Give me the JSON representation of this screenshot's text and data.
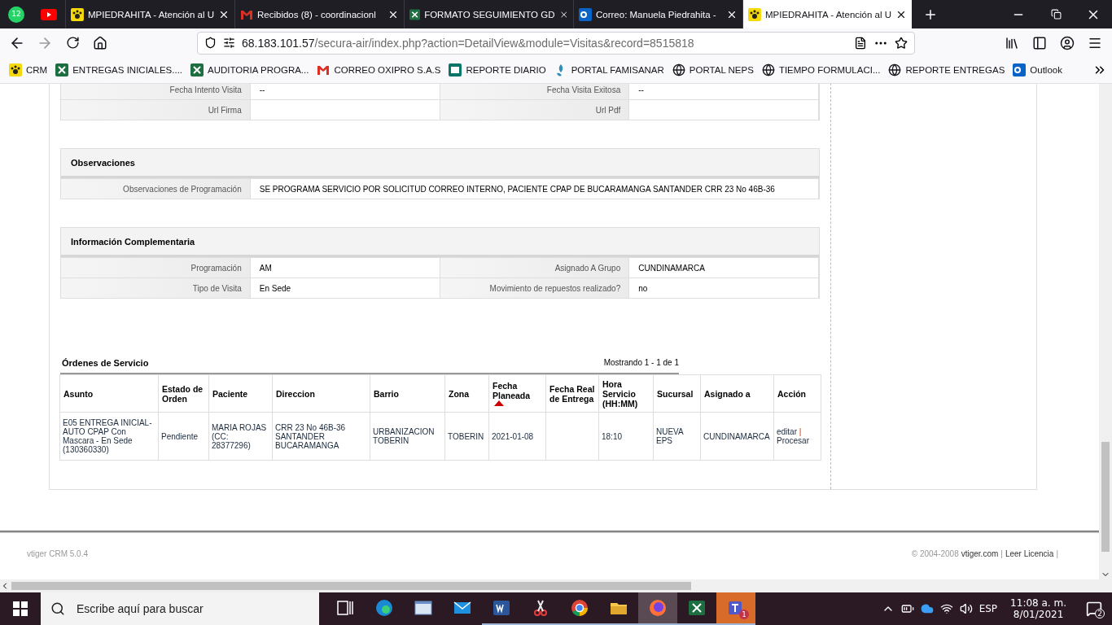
{
  "browser": {
    "tabs": [
      {
        "kind": "whatsapp",
        "badge": "12",
        "selected": false
      },
      {
        "kind": "youtube",
        "selected": false
      },
      {
        "kind": "crm",
        "title": "MPIEDRAHITA - Atención al U",
        "selected": false
      },
      {
        "kind": "gmail",
        "title": "Recibidos (8) - coordinacionl",
        "selected": false
      },
      {
        "kind": "excel",
        "title": "FORMATO SEGUIMIENTO GD",
        "selected": false
      },
      {
        "kind": "outlook",
        "title": "Correo: Manuela Piedrahita -",
        "selected": false
      },
      {
        "kind": "crm",
        "title": "MPIEDRAHITA - Atención al U",
        "selected": true
      }
    ],
    "url": {
      "host": "68.183.101.57",
      "path": "/secura-air/index.php?action=DetailView&module=Visitas&record=8515818"
    },
    "bookmarks": [
      {
        "kind": "crm",
        "label": "CRM"
      },
      {
        "kind": "excel",
        "label": "ENTREGAS INICIALES...."
      },
      {
        "kind": "excel",
        "label": "AUDITORIA PROGRA..."
      },
      {
        "kind": "gmail",
        "label": "CORREO OXIPRO S.A.S"
      },
      {
        "kind": "sheet",
        "label": "REPORTE DIARIO"
      },
      {
        "kind": "famisanar",
        "label": "PORTAL FAMISANAR"
      },
      {
        "kind": "globe",
        "label": "PORTAL NEPS"
      },
      {
        "kind": "globe",
        "label": "TIEMPO FORMULACI..."
      },
      {
        "kind": "globe",
        "label": "REPORTE ENTREGAS"
      },
      {
        "kind": "outlook",
        "label": "Outlook"
      }
    ]
  },
  "fields": [
    [
      {
        "label": "Fecha Intento Visita",
        "value": "--"
      },
      {
        "label": "Fecha Visita Exitosa",
        "value": "--"
      }
    ],
    [
      {
        "label": "Url Firma"
      },
      {
        "label": "Url Pdf"
      }
    ]
  ],
  "sections": [
    {
      "title": "Observaciones",
      "rows": [
        [
          {
            "label": "Observaciones de Programación",
            "value": "SE PROGRAMA SERVICIO POR SOLICITUD CORREO INTERNO, PACIENTE CPAP DE BUCARAMANGA SANTANDER CRR 23 No 46B-36"
          }
        ]
      ]
    },
    {
      "title": "Información Complementaria",
      "rows": [
        [
          {
            "label": "Programación",
            "value": "AM"
          },
          {
            "label": "Asignado A Grupo",
            "value": "CUNDINAMARCA"
          }
        ],
        [
          {
            "label": "Tipo de Visita",
            "value": "En Sede"
          },
          {
            "label": "Movimiento de repuestos realizado?",
            "value": "no"
          }
        ]
      ]
    }
  ],
  "orders": {
    "title": "Órdenes de Servicio",
    "count": "Mostrando 1 - 1 de 1",
    "columns": [
      {
        "label": "Asunto",
        "sorted": false
      },
      {
        "label": "Estado de Orden",
        "sorted": false
      },
      {
        "label": "Paciente",
        "sorted": false
      },
      {
        "label": "Direccion",
        "sorted": false
      },
      {
        "label": "Barrio",
        "sorted": false
      },
      {
        "label": "Zona",
        "sorted": false
      },
      {
        "label": "Fecha Planeada",
        "sorted": true
      },
      {
        "label": "Fecha Real de Entrega",
        "sorted": false
      },
      {
        "label": "Hora Servicio (HH:MM)",
        "sorted": false
      },
      {
        "label": "Sucursal",
        "sorted": false
      },
      {
        "label": "Asignado a",
        "sorted": false
      },
      {
        "label": "Acción",
        "sorted": false
      }
    ],
    "rows": [
      {
        "cells": [
          "E05 ENTREGA INICIAL-AUTO CPAP Con Mascara - En Sede (130360330)",
          "Pendiente",
          "MARIA ROJAS (CC: 28377296)",
          "CRR 23 No 46B-36 SANTANDER BUCARAMANGA",
          "URBANIZACION TOBERIN",
          "TOBERIN",
          "2021-01-08",
          null,
          "18:10",
          "NUEVA EPS",
          "CUNDINAMARCA"
        ],
        "actions": [
          "editar",
          "Procesar"
        ],
        "separator": "|"
      }
    ]
  },
  "footer": {
    "version": "vtiger CRM 5.0.4",
    "copyright": "© 2004-2008",
    "links": [
      "vtiger.com",
      "Leer Licencia"
    ],
    "separator": "|"
  },
  "taskbar": {
    "search_placeholder": "Escribe aquí para buscar",
    "apps": [
      {
        "kind": "taskview",
        "running": false,
        "selected": false
      },
      {
        "kind": "edge",
        "running": false,
        "selected": false
      },
      {
        "kind": "window",
        "running": false,
        "selected": false
      },
      {
        "kind": "mail",
        "running": false,
        "selected": false
      },
      {
        "kind": "word",
        "running": true,
        "selected": false
      },
      {
        "kind": "snip",
        "running": true,
        "selected": false
      },
      {
        "kind": "chrome",
        "running": true,
        "selected": false
      },
      {
        "kind": "explorer",
        "running": true,
        "selected": false
      },
      {
        "kind": "firefox",
        "running": true,
        "selected": true
      },
      {
        "kind": "excel",
        "running": true,
        "selected": false
      },
      {
        "kind": "teams",
        "running": true,
        "selected": false,
        "badge": "1"
      }
    ],
    "language": "ESP",
    "time": "11:08 a. m.",
    "date": "8/01/2021",
    "notifications": "2"
  }
}
